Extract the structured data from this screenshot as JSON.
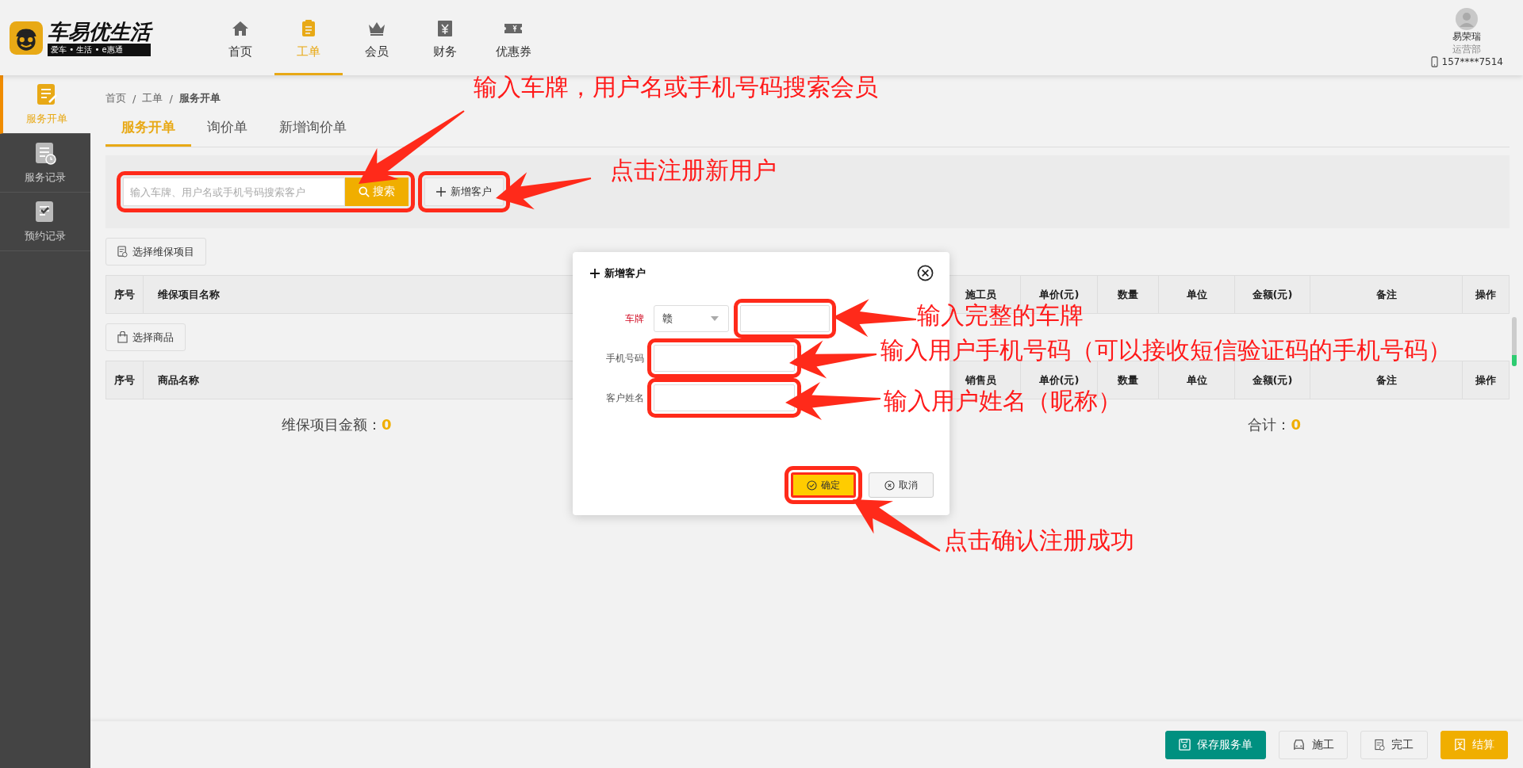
{
  "header": {
    "logo": {
      "title": "车易优生活",
      "tagline": "爱车 • 生活 • e惠通"
    },
    "nav": [
      {
        "label": "首页",
        "selected": false
      },
      {
        "label": "工单",
        "selected": true
      },
      {
        "label": "会员",
        "selected": false
      },
      {
        "label": "财务",
        "selected": false
      },
      {
        "label": "优惠券",
        "selected": false
      }
    ],
    "user": {
      "name": "易荣瑞",
      "department": "运营部",
      "phone": "157****7514"
    }
  },
  "sidebar": {
    "items": [
      {
        "label": "服务开单",
        "selected": true
      },
      {
        "label": "服务记录",
        "selected": false
      },
      {
        "label": "预约记录",
        "selected": false
      }
    ]
  },
  "breadcrumb": [
    {
      "label": "首页",
      "kind": "link"
    },
    {
      "label": "/",
      "kind": "separator"
    },
    {
      "label": "工单",
      "kind": "link"
    },
    {
      "label": "/",
      "kind": "separator"
    },
    {
      "label": "服务开单",
      "kind": "current"
    }
  ],
  "tabs": [
    {
      "label": "服务开单",
      "selected": true
    },
    {
      "label": "询价单",
      "selected": false
    },
    {
      "label": "新增询价单",
      "selected": false
    }
  ],
  "search": {
    "placeholder": "输入车牌、用户名或手机号码搜索客户",
    "button": "搜索",
    "highlighted": true,
    "add_button": {
      "label": "新增客户",
      "highlighted": true
    }
  },
  "maintenance": {
    "button": "选择维保项目",
    "columns": [
      "序号",
      "维保项目名称",
      "施工员",
      "单价(元)",
      "数量",
      "单位",
      "金额(元)",
      "备注",
      "操作"
    ]
  },
  "goods": {
    "button": "选择商品",
    "columns": [
      "序号",
      "商品名称",
      "销售员",
      "单价(元)",
      "数量",
      "单位",
      "金额(元)",
      "备注",
      "操作"
    ]
  },
  "totals": [
    {
      "label": "维保项目金额：",
      "value": "0"
    },
    {
      "label": "合计：",
      "value": "0"
    }
  ],
  "footer_buttons": [
    {
      "label": "保存服务单",
      "kind": "primary"
    },
    {
      "label": "施工",
      "kind": "build"
    },
    {
      "label": "完工",
      "kind": "finish"
    },
    {
      "label": "结算",
      "kind": "settle"
    }
  ],
  "dialog": {
    "title": "新增客户",
    "fields": [
      {
        "label": "车牌",
        "required": true,
        "kind": "plate",
        "prefix": "赣",
        "highlighted": true
      },
      {
        "label": "手机号码",
        "required": false,
        "kind": "text",
        "highlighted": true
      },
      {
        "label": "客户姓名",
        "required": false,
        "kind": "text",
        "highlighted": true
      }
    ],
    "buttons": [
      {
        "label": "确定",
        "kind": "confirm",
        "highlighted": true
      },
      {
        "label": "取消",
        "kind": "cancel",
        "highlighted": false
      }
    ]
  },
  "annotations": [
    "输入车牌，用户名或手机号码搜索会员",
    "点击注册新用户",
    "输入完整的车牌",
    "输入用户手机号码（可以接收短信验证码的手机号码）",
    "输入用户姓名（昵称）",
    "点击确认注册成功"
  ]
}
